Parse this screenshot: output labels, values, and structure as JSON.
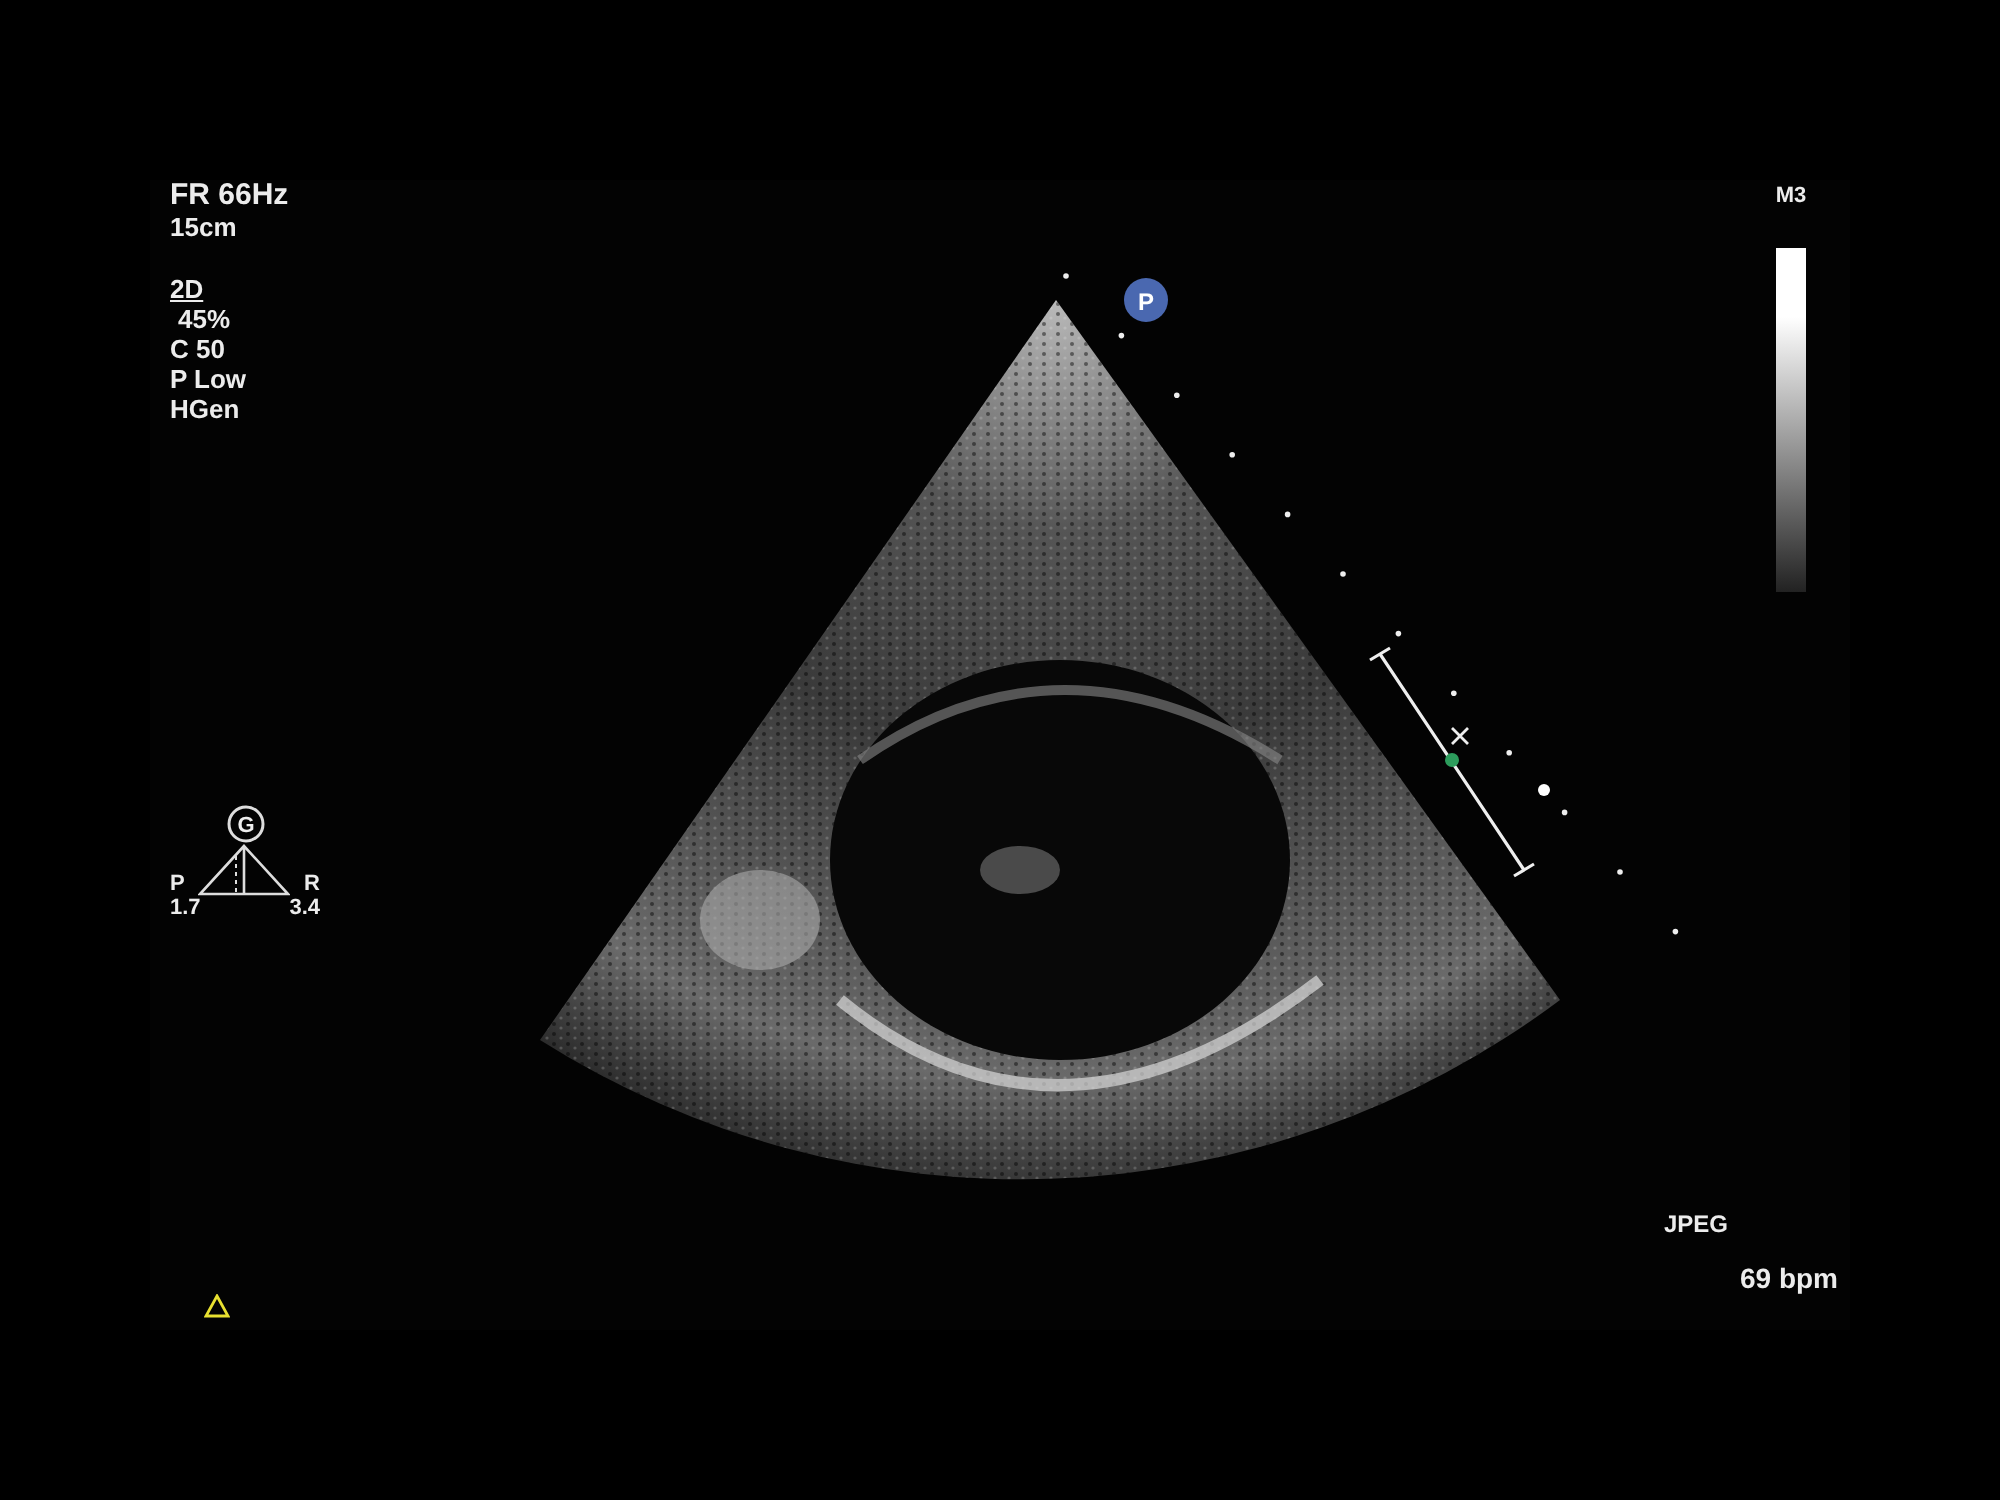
{
  "acquisition": {
    "frame_rate": "FR 66Hz",
    "depth": "15cm"
  },
  "mode": {
    "label": "2D",
    "params": [
      "45%",
      "C 50",
      "P Low",
      "HGen"
    ]
  },
  "orientation": {
    "badge": "G",
    "left_label": "P",
    "right_label": "R",
    "left_value": "1.7",
    "right_value": "3.4"
  },
  "probe_marker": "P",
  "gray_map": {
    "label": "M3"
  },
  "format": "JPEG",
  "heart_rate": "69 bpm"
}
